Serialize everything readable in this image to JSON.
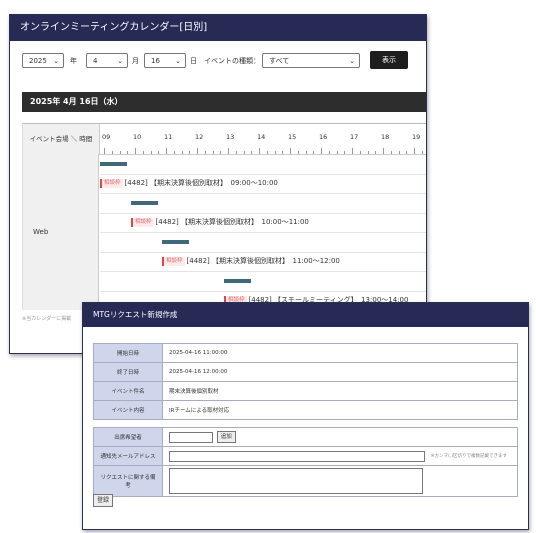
{
  "calendar": {
    "title": "オンラインミーティングカレンダー[日別]",
    "year": "2025",
    "year_unit": "年",
    "month": "4",
    "month_unit": "月",
    "day": "16",
    "day_unit": "日",
    "event_type_label": "イベントの種類：",
    "event_type_value": "すべて",
    "show_button": "表示",
    "date_heading": "2025年 4月 16日（水）",
    "corner_header": "イベント会場 ＼ 時間",
    "venue": "Web",
    "hours": [
      "09",
      "10",
      "11",
      "12",
      "13",
      "14",
      "15",
      "16",
      "17",
      "18",
      "19"
    ],
    "events": [
      {
        "badge": "相談枠",
        "text": "[4482] 【期末決算後個別取材】　09:00～10:00",
        "start": 9.0,
        "end": 10.0
      },
      {
        "badge": "相談枠",
        "text": "[4482] 【期末決算後個別取材】　10:00～11:00",
        "start": 10.0,
        "end": 11.0
      },
      {
        "badge": "相談枠",
        "text": "[4482] 【期末決算後個別取材】　11:00～12:00",
        "start": 11.0,
        "end": 12.0
      },
      {
        "badge": "相談枠",
        "text": "[4482] 【スモールミーティング】　13:00～14:00",
        "start": 13.0,
        "end": 14.0
      }
    ],
    "footnote": "※当カレンダーに掲載"
  },
  "request_form": {
    "title": "MTGリクエスト新規作成",
    "rows": [
      {
        "label": "開始日時",
        "value": "2025-04-16 11:00:00"
      },
      {
        "label": "終了日時",
        "value": "2025-04-16 12:00:00"
      },
      {
        "label": "イベント件名",
        "value": "期末決算後個別取材"
      },
      {
        "label": "イベント内容",
        "value": "IRチームによる取材対応"
      }
    ],
    "attendee_label": "出席希望者",
    "add_button": "追加",
    "email_label": "通知先メールアドレス",
    "email_hint": "※カンマ(,)区切りで複数記載できます",
    "note_label": "リクエストに関する備考",
    "register_button": "登録"
  },
  "colors": {
    "titlebar": "#262a55",
    "event_bar": "#3f6878",
    "badge": "#e04444",
    "form_label_bg": "#cfd6ec"
  }
}
